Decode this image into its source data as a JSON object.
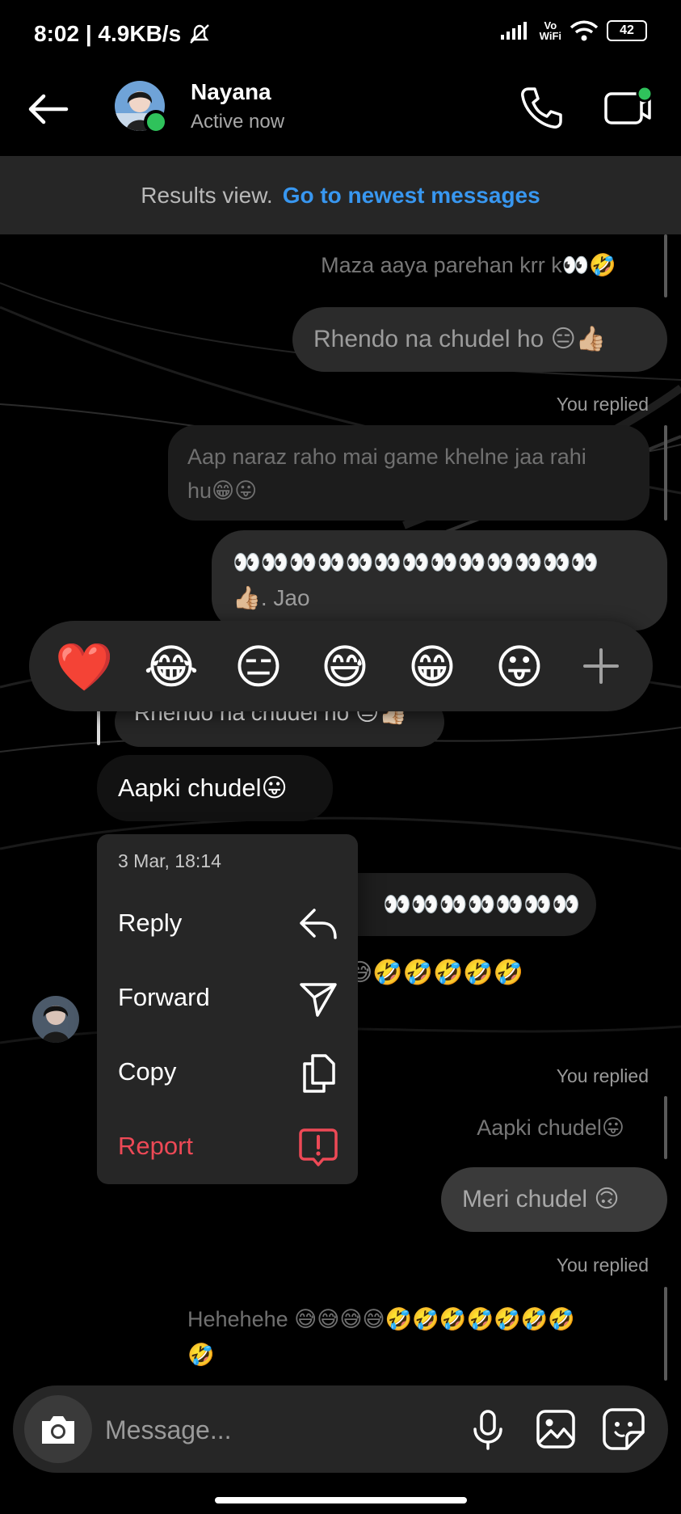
{
  "status_bar": {
    "time_speed": "8:02 | 4.9KB/s",
    "vowifi_top": "Vo",
    "vowifi_bottom": "WiFi",
    "battery": "42"
  },
  "header": {
    "contact_name": "Nayana",
    "contact_status": "Active now"
  },
  "banner": {
    "text": "Results view.",
    "link": "Go to newest messages"
  },
  "messages": {
    "m1_quoted": "Maza aaya parehan krr k👀🤣",
    "m2_sent": "Rhendo na chudel ho 😑👍🏼",
    "m3_label": "You replied",
    "m3_quoted_line1": "Aap naraz raho mai game khelne jaa rahi",
    "m3_quoted_line2": "hu😁😛",
    "m4_sent_line1": "👀👀👀👀👀👀👀👀👀👀👀👀👀",
    "m4_sent_line2": "👍🏼. Jao",
    "m5_quoted_partial": "Rhendo na chudel ho 😑👍🏻",
    "m6_received": "Aapki chudel😛",
    "m7_partial": "👀👀👀👀👀👀👀👍🏼. Jao",
    "m8_partial": "😅🤣🤣🤣🤣🤣",
    "m9_label": "You replied",
    "m9_quoted": "Aapki chudel😛",
    "m10_sent": "Meri chudel 🙃",
    "m11_label": "You replied",
    "m11_quoted_line1": "Hehehehe 😅😅😅😅🤣🤣🤣🤣🤣🤣🤣",
    "m11_quoted_line2": "🤣"
  },
  "reactions": [
    "❤️",
    "😂",
    "😑",
    "😅",
    "😁",
    "😛"
  ],
  "context_menu": {
    "timestamp": "3 Mar, 18:14",
    "items": [
      {
        "label": "Reply",
        "icon": "reply-icon"
      },
      {
        "label": "Forward",
        "icon": "send-icon"
      },
      {
        "label": "Copy",
        "icon": "copy-icon"
      },
      {
        "label": "Report",
        "icon": "report-icon"
      }
    ]
  },
  "composer": {
    "placeholder": "Message..."
  },
  "colors": {
    "accent_link": "#3897f0",
    "report_red": "#ed4956",
    "online_green": "#2fc25b",
    "bubble_sent": "#2a2a2a",
    "menu_bg": "#262626"
  }
}
